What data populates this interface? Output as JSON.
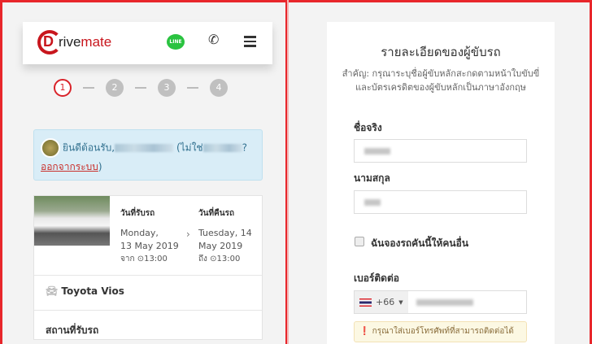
{
  "header": {
    "logo_text": "Drivemate",
    "logo_letter": "D",
    "logo_part1": "rive",
    "logo_part2": "mate",
    "line_label": "LINE"
  },
  "steps": [
    "1",
    "2",
    "3",
    "4"
  ],
  "welcome": {
    "greeting": "ยินดีต้อนรับ,",
    "not_you": "(ไม่ใช่",
    "question": "?",
    "logout": "ออกจากระบบ",
    "close_paren": ")"
  },
  "booking": {
    "pickup_label": "วันที่รับรถ",
    "pickup_day": "Monday,",
    "pickup_date": "13 May 2019",
    "pickup_time": "จาก ⊙13:00",
    "return_label": "วันที่คืนรถ",
    "return_day": "Tuesday, 14",
    "return_date": "May 2019",
    "return_time": "ถึง ⊙13:00",
    "arrow": "›",
    "car_model": "Toyota Vios",
    "pickup_place_label": "สถานที่รับรถ"
  },
  "form": {
    "title": "รายละเอียดของผู้ขับรถ",
    "note": "สำคัญ: กรุณาระบุชื่อผู้ขับหลักสะกดตามหน้าใบขับขี่และบัตรเครดิตของผู้ขับหลักเป็นภาษาอังกฤษ",
    "first_name_label": "ชื่อจริง",
    "last_name_label": "นามสกุล",
    "book_for_other": "ฉันจองรถคันนี้ให้คนอื่น",
    "phone_label": "เบอร์ติดต่อ",
    "country_code": "+66",
    "warning": "กรุณาใส่เบอร์โทรศัพท์ที่สามารถติดต่อได้"
  }
}
